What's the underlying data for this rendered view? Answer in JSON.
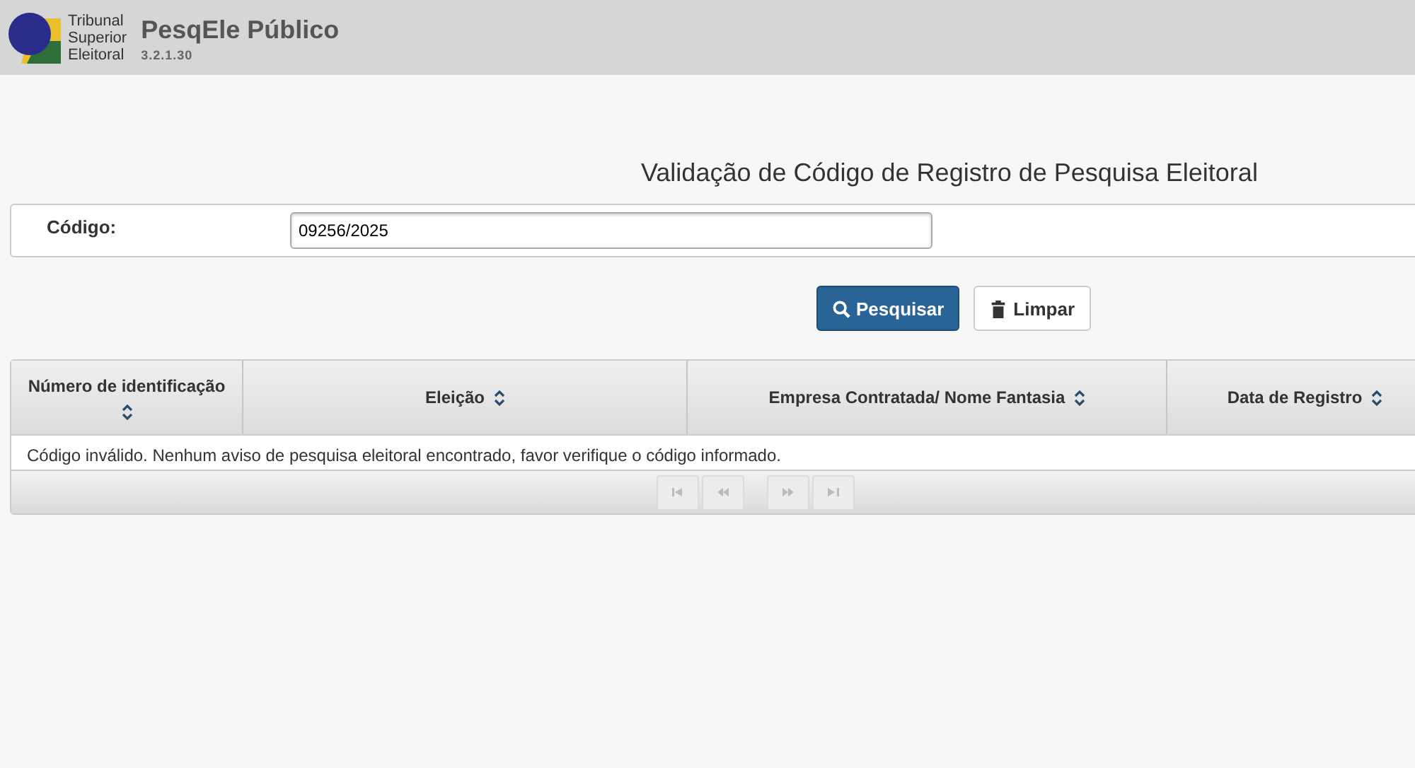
{
  "header": {
    "org_lines": [
      "Tribunal",
      "Superior",
      "Eleitoral"
    ],
    "app_title": "PesqEle Público",
    "version": "3.2.1.30"
  },
  "page_title": "Validação de Código de Registro de Pesquisa Eleitoral",
  "form": {
    "label": "Código:",
    "value": "09256/2025"
  },
  "buttons": [
    {
      "label": "Pesquisar",
      "kind": "search"
    },
    {
      "label": "Limpar",
      "kind": "clear"
    }
  ],
  "table": {
    "columns": [
      {
        "label": "Número de identificação",
        "sortable": true
      },
      {
        "label": "Eleição",
        "sortable": true
      },
      {
        "label": "Empresa Contratada/ Nome Fantasia",
        "sortable": true
      },
      {
        "label": "Data de Registro",
        "sortable": true
      }
    ],
    "message": "Código inválido. Nenhum aviso de pesquisa eleitoral encontrado, favor verifique o código informado.",
    "pager": [
      {
        "kind": "first",
        "disabled": true
      },
      {
        "kind": "prev",
        "disabled": true
      },
      {
        "kind": "next",
        "disabled": true
      },
      {
        "kind": "last",
        "disabled": true
      }
    ]
  }
}
